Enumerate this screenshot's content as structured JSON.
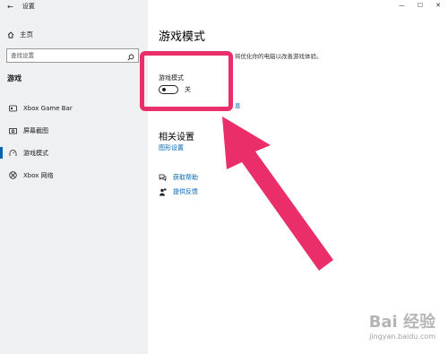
{
  "window": {
    "title": "设置",
    "back_glyph": "←",
    "min_glyph": "—",
    "max_glyph": "☐",
    "close_glyph": "✕"
  },
  "sidebar": {
    "home_label": "主页",
    "search_placeholder": "查找设置",
    "section_title": "游戏",
    "items": [
      {
        "label": "Xbox Game Bar",
        "icon": "xbox-game-bar-icon",
        "selected": false
      },
      {
        "label": "屏幕截图",
        "icon": "capture-icon",
        "selected": false
      },
      {
        "label": "游戏模式",
        "icon": "game-mode-icon",
        "selected": true
      },
      {
        "label": "Xbox 网络",
        "icon": "xbox-network-icon",
        "selected": false
      }
    ]
  },
  "main": {
    "title": "游戏模式",
    "description": "将优化你的电脑以改善游戏体验。",
    "hidden_link_tail": "息",
    "toggle_label": "游戏模式",
    "toggle_state": "关",
    "related_title": "相关设置",
    "related_link": "图形设置",
    "help_items": [
      {
        "label": "获取帮助",
        "icon": "help-chat-icon"
      },
      {
        "label": "提供反馈",
        "icon": "feedback-icon"
      }
    ]
  },
  "annotation": {
    "color": "#ea2e6a"
  },
  "watermark": {
    "logo": "Bai 经验",
    "url": "jingyan.baidu.com"
  }
}
